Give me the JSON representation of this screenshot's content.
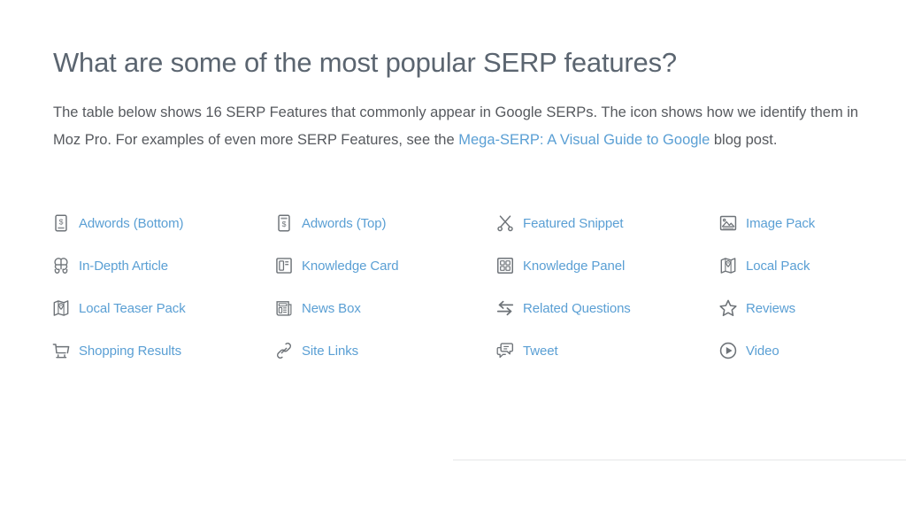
{
  "page": {
    "title": "What are some of the most popular SERP features?",
    "intro": {
      "before_link": "The table below shows 16 SERP Features that commonly appear in Google SERPs. The icon shows how we identify them in Moz Pro. For examples of even more SERP Features, see the ",
      "link_text": "Mega-SERP: A Visual Guide to Google",
      "after_link": " blog post."
    }
  },
  "colors": {
    "background": "#ffffff",
    "heading": "#5b6570",
    "body_text": "#56595e",
    "link": "#5a9fd4",
    "icon": "#6e7378",
    "divider": "#e6e7e8"
  },
  "features": [
    {
      "label": "Adwords (Bottom)",
      "icon": "adwords-bottom-icon"
    },
    {
      "label": "Adwords (Top)",
      "icon": "adwords-top-icon"
    },
    {
      "label": "Featured Snippet",
      "icon": "scissors-icon"
    },
    {
      "label": "Image Pack",
      "icon": "image-pack-icon"
    },
    {
      "label": "In-Depth Article",
      "icon": "brain-icon"
    },
    {
      "label": "Knowledge Card",
      "icon": "knowledge-card-icon"
    },
    {
      "label": "Knowledge Panel",
      "icon": "knowledge-panel-icon"
    },
    {
      "label": "Local Pack",
      "icon": "map-pin-icon"
    },
    {
      "label": "Local Teaser Pack",
      "icon": "map-pin-icon"
    },
    {
      "label": "News Box",
      "icon": "newspaper-icon"
    },
    {
      "label": "Related Questions",
      "icon": "two-arrows-icon"
    },
    {
      "label": "Reviews",
      "icon": "star-icon"
    },
    {
      "label": "Shopping Results",
      "icon": "cart-icon"
    },
    {
      "label": "Site Links",
      "icon": "chain-link-icon"
    },
    {
      "label": "Tweet",
      "icon": "speech-bubbles-icon"
    },
    {
      "label": "Video",
      "icon": "play-circle-icon"
    }
  ]
}
